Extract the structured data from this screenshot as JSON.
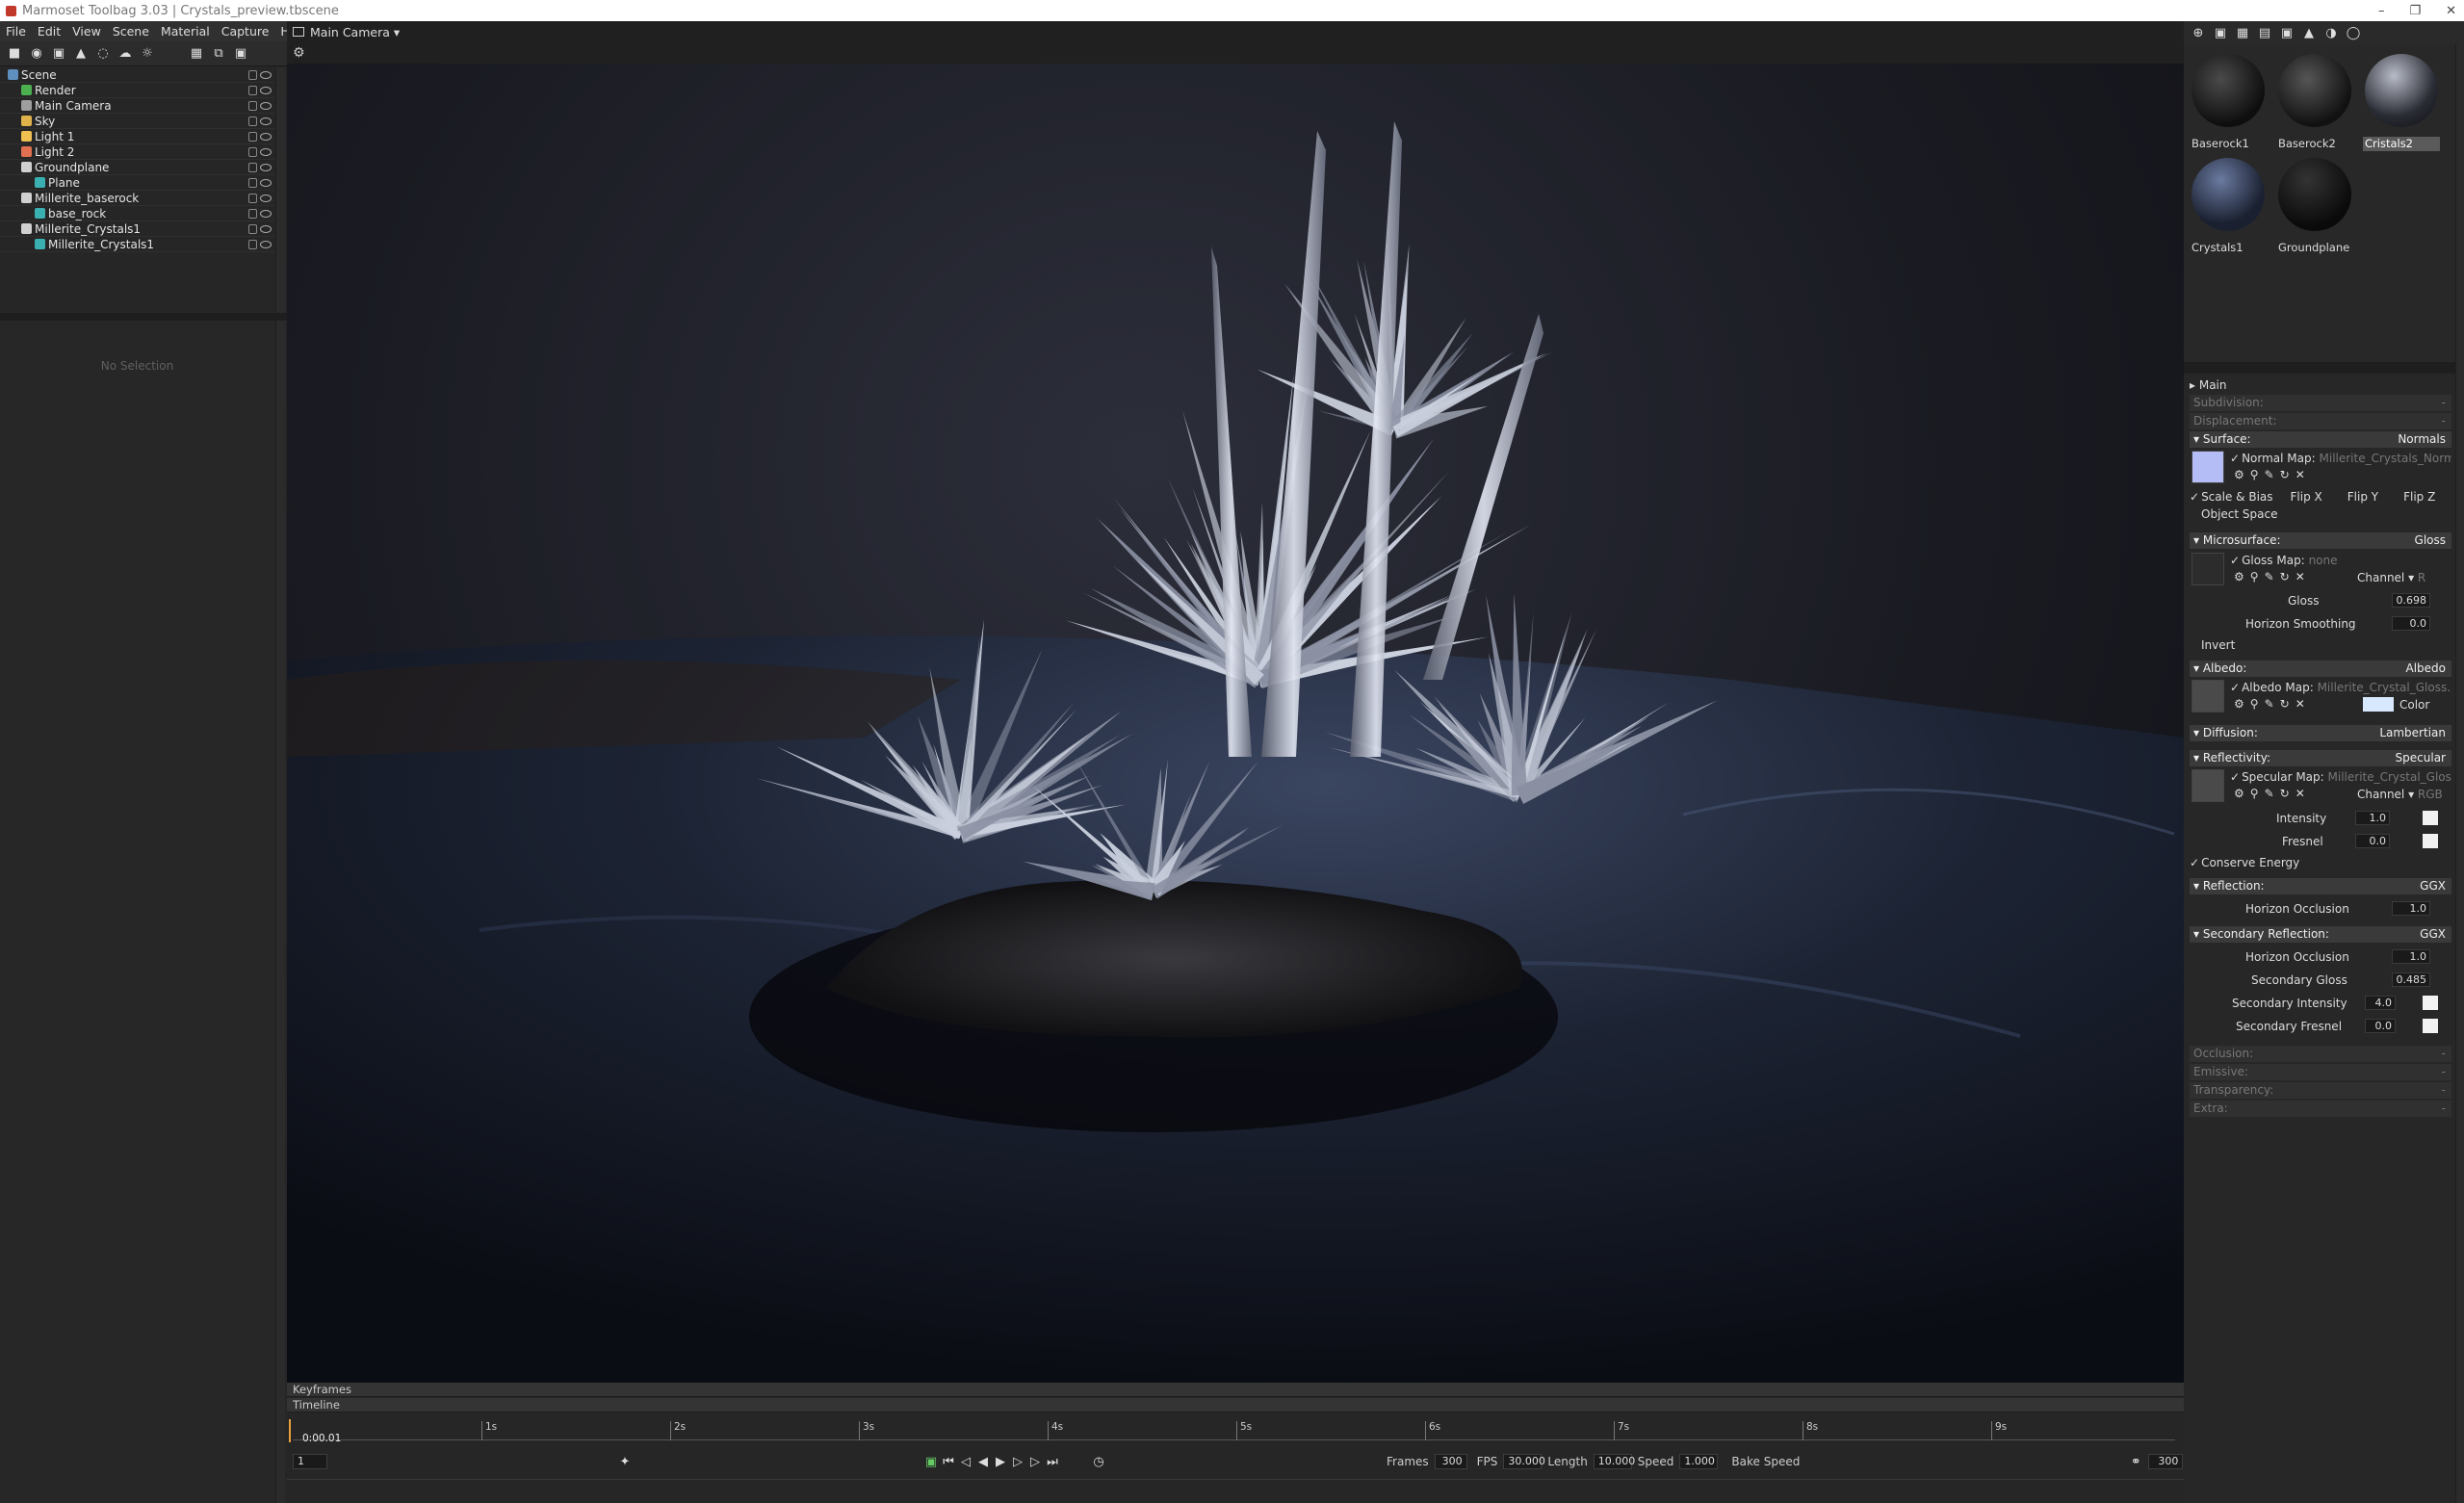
{
  "window": {
    "title": "Marmoset Toolbag 3.03  |  Crystals_preview.tbscene",
    "controls": [
      "–",
      "❐",
      "✕"
    ]
  },
  "menu": [
    "File",
    "Edit",
    "View",
    "Scene",
    "Material",
    "Capture",
    "Help"
  ],
  "outliner": {
    "items": [
      {
        "label": "Scene",
        "depth": 0,
        "icon": "scene-icon",
        "color": "#5f8fbf"
      },
      {
        "label": "Render",
        "depth": 1,
        "icon": "render-icon",
        "color": "#4caf50"
      },
      {
        "label": "Main Camera",
        "depth": 1,
        "icon": "camera-icon",
        "color": "#9e9e9e"
      },
      {
        "label": "Sky",
        "depth": 1,
        "icon": "sky-icon",
        "color": "#e0b24a"
      },
      {
        "label": "Light 1",
        "depth": 1,
        "icon": "light-icon",
        "color": "#f0c050"
      },
      {
        "label": "Light 2",
        "depth": 1,
        "icon": "light-icon",
        "color": "#e07050"
      },
      {
        "label": "Groundplane",
        "depth": 1,
        "icon": "object-icon",
        "color": "#d0d0d0"
      },
      {
        "label": "Plane",
        "depth": 2,
        "icon": "mesh-icon",
        "color": "#3bb0b0"
      },
      {
        "label": "Millerite_baserock",
        "depth": 1,
        "icon": "object-icon",
        "color": "#d0d0d0"
      },
      {
        "label": "base_rock",
        "depth": 2,
        "icon": "mesh-icon",
        "color": "#3bb0b0"
      },
      {
        "label": "Millerite_Crystals1",
        "depth": 1,
        "icon": "object-icon",
        "color": "#d0d0d0"
      },
      {
        "label": "Millerite_Crystals1",
        "depth": 2,
        "icon": "mesh-icon",
        "color": "#3bb0b0"
      }
    ]
  },
  "properties": {
    "empty_text": "No Selection"
  },
  "viewport": {
    "camera_label": "Main Camera ▾"
  },
  "timeline": {
    "keyframes_label": "Keyframes",
    "timeline_label": "Timeline",
    "current_time": "0:00.01",
    "ticks": [
      "1s",
      "2s",
      "3s",
      "4s",
      "5s",
      "6s",
      "7s",
      "8s",
      "9s"
    ],
    "frame_field": "1",
    "frames_label": "Frames",
    "frames_value": "300",
    "fps_label": "FPS",
    "fps_value": "30.000",
    "length_label": "Length",
    "length_value": "10.000",
    "speed_label": "Speed",
    "speed_value": "1.000",
    "bake_label": "Bake Speed",
    "end_frame": "300"
  },
  "materials": {
    "items": [
      {
        "name": "Baserock1",
        "selected": false
      },
      {
        "name": "Baserock2",
        "selected": false
      },
      {
        "name": "Cristals2",
        "selected": true
      },
      {
        "name": "Crystals1",
        "selected": false
      },
      {
        "name": "Groundplane",
        "selected": false
      }
    ]
  },
  "material_props": {
    "main": "Main",
    "subdivision": "Subdivision:",
    "displacement": "Displacement:",
    "dash": "-",
    "surface": "Surface:",
    "surface_mode": "Normals",
    "normal_map_label": "Normal Map:",
    "normal_map_file": "Millerite_Crystals_Normals",
    "scale_bias": "Scale & Bias",
    "flip_x": "Flip X",
    "flip_y": "Flip Y",
    "flip_z": "Flip Z",
    "object_space": "Object Space",
    "microsurface": "Microsurface:",
    "microsurface_mode": "Gloss",
    "gloss_map_label": "Gloss Map:",
    "gloss_map_file": "none",
    "channel": "Channel",
    "channel_r": "R",
    "gloss": "Gloss",
    "gloss_value": "0.698",
    "horizon_smoothing": "Horizon Smoothing",
    "horizon_smoothing_value": "0.0",
    "invert": "Invert",
    "albedo": "Albedo:",
    "albedo_mode": "Albedo",
    "albedo_map_label": "Albedo Map:",
    "albedo_map_file": "Millerite_Crystal_Gloss.png",
    "color": "Color",
    "diffusion": "Diffusion:",
    "diffusion_mode": "Lambertian",
    "reflectivity": "Reflectivity:",
    "reflectivity_mode": "Specular",
    "specular_map_label": "Specular Map:",
    "specular_map_file": "Millerite_Crystal_Gloss.png",
    "channel_rgb": "RGB",
    "intensity": "Intensity",
    "intensity_value": "1.0",
    "fresnel": "Fresnel",
    "fresnel_value": "0.0",
    "conserve_energy": "Conserve Energy",
    "reflection": "Reflection:",
    "reflection_mode": "GGX",
    "horizon_occlusion": "Horizon Occlusion",
    "horizon_occlusion_value": "1.0",
    "secondary_reflection": "Secondary Reflection:",
    "secondary_reflection_mode": "GGX",
    "horizon_occlusion2_value": "1.0",
    "secondary_gloss": "Secondary Gloss",
    "secondary_gloss_value": "0.485",
    "secondary_intensity": "Secondary Intensity",
    "secondary_intensity_value": "4.0",
    "secondary_fresnel": "Secondary Fresnel",
    "secondary_fresnel_value": "0.0",
    "occlusion": "Occlusion:",
    "emissive": "Emissive:",
    "transparency": "Transparency:",
    "extra": "Extra:"
  }
}
